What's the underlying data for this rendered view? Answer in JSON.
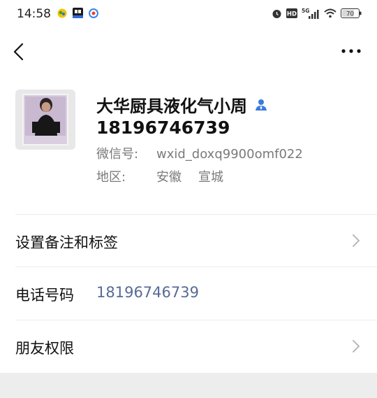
{
  "statusbar": {
    "time": "14:58",
    "icons_left": [
      "app-notif-icon",
      "news-icon",
      "browser-icon"
    ],
    "icons_right": [
      "alarm-icon",
      "hd-icon",
      "5g-signal-icon",
      "wifi-icon",
      "battery-icon"
    ],
    "network": "5G",
    "hd": "HD",
    "battery": "70"
  },
  "appbar": {
    "back_icon": "chevron-left-icon",
    "more_icon": "more-dots-icon"
  },
  "profile": {
    "name": "大华厨具液化气小周",
    "phone": "18196746739",
    "wechat_label": "微信号:",
    "wechat_id": "wxid_doxq9900omf022",
    "region_label": "地区:",
    "region_province": "安徽",
    "region_city": "宣城"
  },
  "rows": {
    "remark": {
      "label": "设置备注和标签"
    },
    "phone": {
      "label": "电话号码",
      "value": "18196746739"
    },
    "moments": {
      "label": "朋友权限"
    }
  },
  "colors": {
    "link": "#576b95",
    "badge": "#3b7be0",
    "divider": "#ececec",
    "footer_bg": "#ededed"
  }
}
